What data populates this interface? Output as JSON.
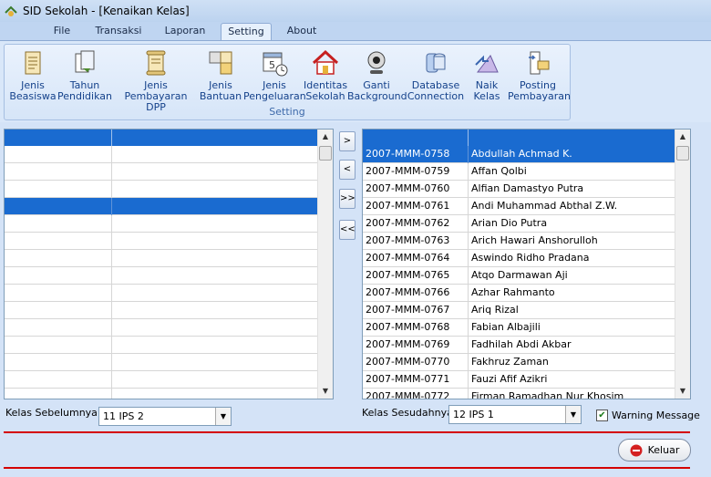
{
  "window": {
    "title": "SID Sekolah - [Kenaikan Kelas]"
  },
  "menu": {
    "tabs": [
      {
        "label": "File",
        "active": false
      },
      {
        "label": "Transaksi",
        "active": false
      },
      {
        "label": "Laporan",
        "active": false
      },
      {
        "label": "Setting",
        "active": true
      },
      {
        "label": "About",
        "active": false
      }
    ]
  },
  "ribbon": {
    "group_label": "Setting",
    "buttons": [
      {
        "line1": "Jenis",
        "line2": "Beasiswa",
        "icon": "document-icon"
      },
      {
        "line1": "Tahun",
        "line2": "Pendidikan",
        "icon": "document-copy-icon"
      },
      {
        "line1": "Jenis Pembayaran",
        "line2": "DPP",
        "icon": "scroll-icon"
      },
      {
        "line1": "Jenis",
        "line2": "Bantuan",
        "icon": "boxes-icon"
      },
      {
        "line1": "Jenis",
        "line2": "Pengeluaran",
        "icon": "calendar-clock-icon"
      },
      {
        "line1": "Identitas",
        "line2": "Sekolah",
        "icon": "house-icon"
      },
      {
        "line1": "Ganti",
        "line2": "Background",
        "icon": "webcam-icon"
      },
      {
        "line1": "Database",
        "line2": "Connection",
        "icon": "database-icon"
      },
      {
        "line1": "Naik",
        "line2": "Kelas",
        "icon": "triangle-icon"
      },
      {
        "line1": "Posting",
        "line2": "Pembayaran",
        "icon": "posting-icon"
      }
    ]
  },
  "left_grid": {
    "rows": [
      "",
      "",
      "",
      "",
      "",
      "",
      "",
      "",
      "",
      "",
      "",
      "",
      "",
      "",
      ""
    ],
    "selected_row": 3
  },
  "right_grid": {
    "selected_row": 0,
    "rows": [
      {
        "nis": "2007-MMM-0758",
        "nama": "Abdullah Achmad K."
      },
      {
        "nis": "2007-MMM-0759",
        "nama": "Affan Qolbi"
      },
      {
        "nis": "2007-MMM-0760",
        "nama": "Alfian Damastyo Putra"
      },
      {
        "nis": "2007-MMM-0761",
        "nama": "Andi Muhammad Abthal Z.W."
      },
      {
        "nis": "2007-MMM-0762",
        "nama": "Arian Dio Putra"
      },
      {
        "nis": "2007-MMM-0763",
        "nama": "Arich Hawari Anshorulloh"
      },
      {
        "nis": "2007-MMM-0764",
        "nama": "Aswindo Ridho Pradana"
      },
      {
        "nis": "2007-MMM-0765",
        "nama": "Atqo Darmawan Aji"
      },
      {
        "nis": "2007-MMM-0766",
        "nama": "Azhar Rahmanto"
      },
      {
        "nis": "2007-MMM-0767",
        "nama": "Ariq Rizal"
      },
      {
        "nis": "2007-MMM-0768",
        "nama": "Fabian Albajili"
      },
      {
        "nis": "2007-MMM-0769",
        "nama": "Fadhilah Abdi Akbar"
      },
      {
        "nis": "2007-MMM-0770",
        "nama": "Fakhruz Zaman"
      },
      {
        "nis": "2007-MMM-0771",
        "nama": "Fauzi Afif Azikri"
      },
      {
        "nis": "2007-MMM-0772",
        "nama": "Firman Ramadhan Nur Khosim"
      }
    ]
  },
  "move_buttons": [
    ">",
    "<",
    ">>",
    "<<"
  ],
  "form": {
    "kelas_sebelumnya_label": "Kelas Sebelumnya",
    "kelas_sebelumnya_value": "11 IPS 2",
    "kelas_sesudahnya_label": "Kelas Sesudahnya",
    "kelas_sesudahnya_value": "12 IPS 1",
    "warning_label": "Warning Message",
    "warning_checked": true
  },
  "footer": {
    "exit_label": "Keluar"
  },
  "colors": {
    "selection": "#1a6bd0",
    "separator": "#d40000",
    "ribbon_text": "#15428b"
  }
}
